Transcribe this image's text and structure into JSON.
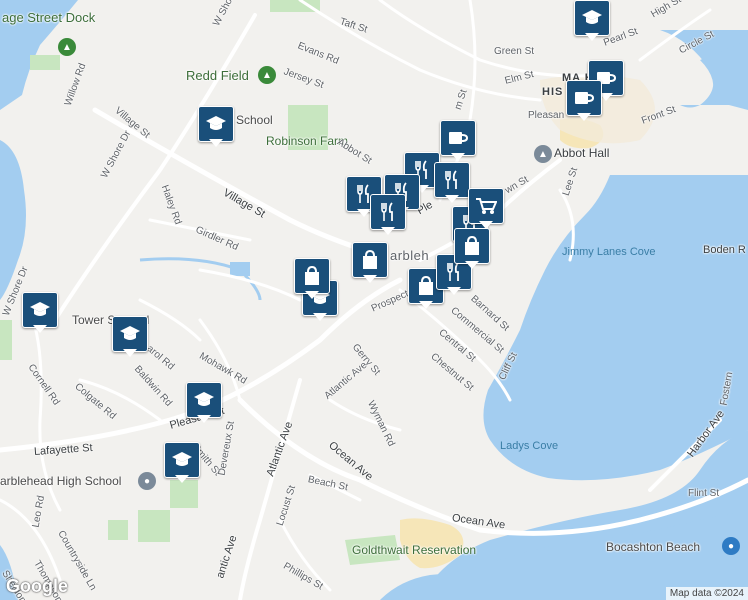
{
  "attribution": "Map data ©2024",
  "logo": "Google",
  "colors": {
    "water": "#a3cdf0",
    "land": "#f2f1ee",
    "park": "#c8e6c0",
    "road": "#ffffff",
    "marker": "#1a4f7a",
    "beach": "#f6e6b8"
  },
  "places": {
    "dock": "age Street Dock",
    "redd_field": "Redd Field",
    "village_school": "V",
    "village_school_tail": "School",
    "robinson_farm": "Robinson Farm",
    "abbot_hall": "Abbot Hall",
    "tower_school": "Tower S",
    "tower_school_tail": "ol",
    "marblehead_high": "arblehead High School",
    "jimmy_lanes_cove": "Jimmy Lanes Cove",
    "ladys_cove": "Ladys Cove",
    "bocashton_beach": "Bocashton Beach",
    "goldthwait": "Goldthwait Reservation",
    "boden": "Boden R",
    "historic_1": "MA      HEAD",
    "historic_2": "HIS           ISTRICT",
    "marblehead_town": "arbleh"
  },
  "streets": {
    "taft": "Taft St",
    "evans": "Evans Rd",
    "green": "Green St",
    "jersey": "Jersey St",
    "elm": "Elm St",
    "willow": "Willow Rd",
    "village_st_top": "Village St",
    "w_shore_top": "W Shore Dr",
    "w_shore_mid": "W Shore Dr",
    "w_shore_low": "W Shore Dr",
    "abbot": "Abbot St",
    "haley": "Haley Rd",
    "girdler": "Girdler Rd",
    "village_st": "Village St",
    "pearl": "Pearl St",
    "high": "High St",
    "circle": "Circle St",
    "pleasant_top": "Pleasan",
    "front": "Front St",
    "lee": "Lee St",
    "ple": "Ple",
    "wn": "wn St",
    "m_st": "m St",
    "prospect": "Prospect",
    "barnard": "Barnard St",
    "commercial": "Commercial St",
    "central": "Central St",
    "chestnut": "Chestnut St",
    "cliff": "Cliff St",
    "gerry": "Gerry St",
    "atlantic_ave_mid": "Atlantic Ave",
    "wyman": "Wyman Rd",
    "mohawk": "Mohawk Rd",
    "baldwin": "Baldwin Rd",
    "colgate": "Colgate Rd",
    "cornell": "Cornell Rd",
    "carol": "arol Rd",
    "pleasant_st": "Pleasant St",
    "smith": "Smith St",
    "lafayette": "Lafayette St",
    "devereux": "Devereux St",
    "atlantic_ave_low": "Atlantic Ave",
    "ocean_ave_mid": "Ocean Ave",
    "beach": "Beach St",
    "locust": "Locust St",
    "phillips": "Phillips St",
    "ocean_ave_low": "Ocean Ave",
    "harbor": "Harbor Ave",
    "flint": "Flint St",
    "fostern": "Fostern",
    "leo": "Leo Rd",
    "thompson": "Thompson Rd",
    "countryside": "Countryside Ln",
    "sheldon": "Sheldon Rd",
    "atlantic_ave_bottom": "antic Ave"
  },
  "marker_icons": {
    "school": "school-icon",
    "restaurant": "restaurant-icon",
    "cafe": "cafe-icon",
    "shopping": "shopping-bag-icon",
    "grocery": "grocery-cart-icon"
  }
}
